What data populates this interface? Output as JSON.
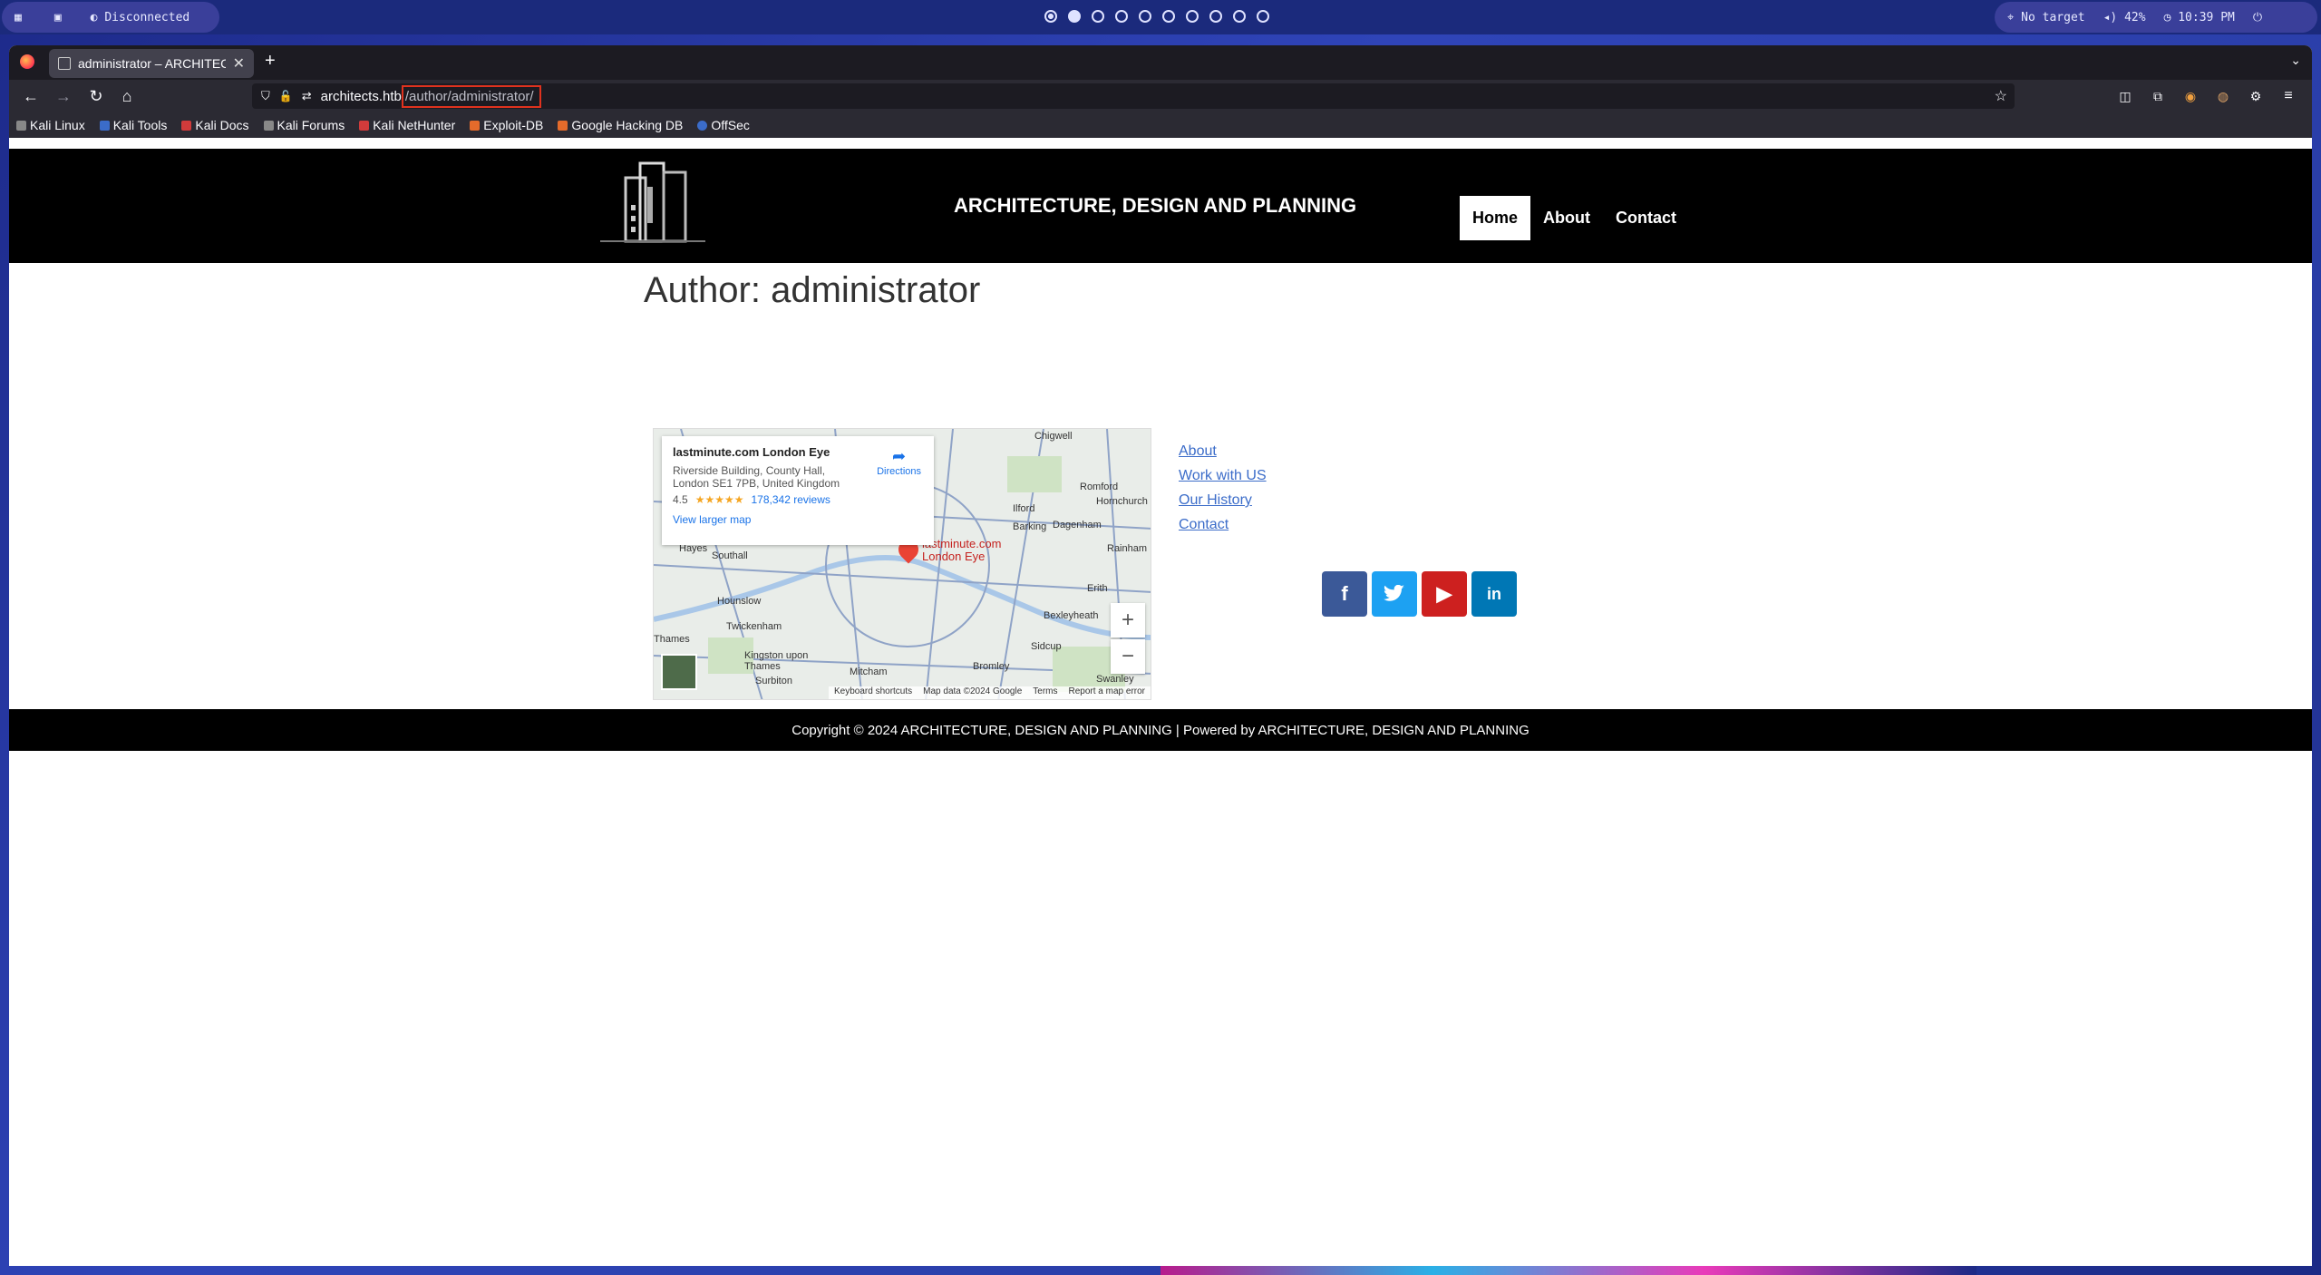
{
  "os": {
    "status": "Disconnected",
    "target": "No target",
    "volume": "42%",
    "time": "10:39 PM",
    "workspaces": 10,
    "active_workspace": 2
  },
  "browser": {
    "tab_title": "administrator – ARCHITEC",
    "url_host": "architects.htb",
    "url_path": "/author/administrator/",
    "bookmarks": [
      "Kali Linux",
      "Kali Tools",
      "Kali Docs",
      "Kali Forums",
      "Kali NetHunter",
      "Exploit-DB",
      "Google Hacking DB",
      "OffSec"
    ]
  },
  "site": {
    "title": "ARCHITECTURE, DESIGN AND PLANNING",
    "menu": [
      "Home",
      "About",
      "Contact"
    ],
    "page_title": "Author: administrator",
    "links": [
      "About",
      "Work with US",
      "Our History",
      "Contact"
    ],
    "copyright": "Copyright © 2024 ARCHITECTURE, DESIGN AND PLANNING | Powered by ARCHITECTURE, DESIGN AND PLANNING"
  },
  "map": {
    "place": "lastminute.com London Eye",
    "address": "Riverside Building, County Hall, London SE1 7PB, United Kingdom",
    "rating": "4.5",
    "stars": "★★★★★",
    "reviews": "178,342 reviews",
    "directions": "Directions",
    "larger_map": "View larger map",
    "pin_label": "lastminute.com London Eye",
    "labels": [
      "Chigwell",
      "Romford",
      "Hornchurch",
      "Ilford",
      "Barking",
      "Dagenham",
      "Rainham",
      "Hayes",
      "Southall",
      "Hounslow",
      "Erith",
      "Bexleyheath",
      "Twickenham",
      "Kingston upon Thames",
      "Surbiton",
      "Mitcham",
      "Bromley",
      "Sidcup",
      "Swanley",
      "Thames"
    ],
    "footer": [
      "Keyboard shortcuts",
      "Map data ©2024 Google",
      "Terms",
      "Report a map error"
    ]
  },
  "colors": {
    "facebook": "#3b5998",
    "twitter": "#1da1f2",
    "youtube": "#cd201f",
    "linkedin": "#0077b5"
  }
}
